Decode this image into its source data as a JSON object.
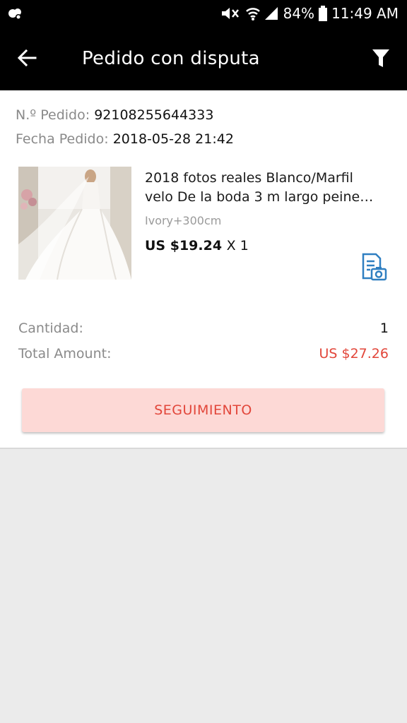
{
  "status_bar": {
    "battery": "84%",
    "time": "11:49 AM"
  },
  "app_bar": {
    "title": "Pedido con disputa"
  },
  "order": {
    "number_label": "N.º Pedido:",
    "number_value": "92108255644333",
    "date_label": "Fecha Pedido:",
    "date_value": "2018-05-28 21:42"
  },
  "product": {
    "title": "2018 fotos reales Blanco/Marfil velo De la boda 3 m largo peine D...",
    "variant": "Ivory+300cm",
    "price": "US $19.24",
    "quantity": "X 1"
  },
  "summary": {
    "quantity_label": "Cantidad:",
    "quantity_value": "1",
    "total_label": "Total Amount:",
    "total_value": "US $27.26"
  },
  "actions": {
    "track_label": "SEGUIMIENTO"
  },
  "colors": {
    "accent_red": "#e2463a",
    "button_bg": "#fdd9d6",
    "app_bar": "#000000",
    "evidence_icon": "#2f7fc1"
  },
  "icons": {
    "status_left": "weather-icon",
    "mute": "mute-icon",
    "wifi": "wifi-icon",
    "signal": "signal-icon",
    "battery": "battery-icon",
    "back": "back-arrow-icon",
    "filter": "filter-icon",
    "evidence": "document-camera-icon"
  }
}
